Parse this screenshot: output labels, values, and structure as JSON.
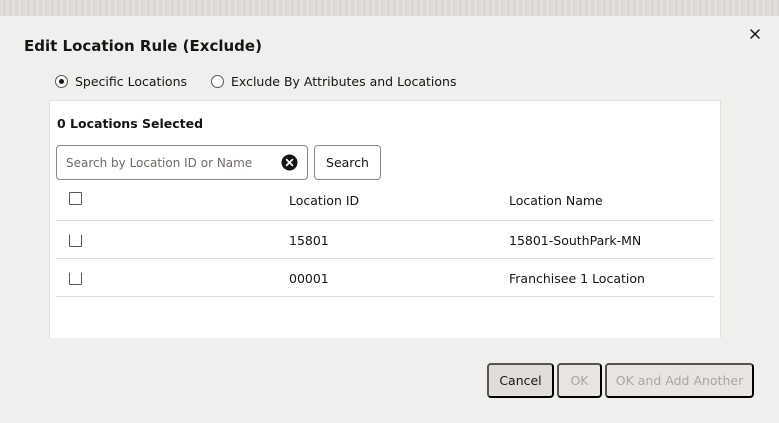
{
  "dialog": {
    "title": "Edit Location Rule (Exclude)",
    "close_icon": "close-icon"
  },
  "mode": {
    "options": [
      {
        "label": "Specific Locations",
        "selected": true
      },
      {
        "label": "Exclude By Attributes and Locations",
        "selected": false
      }
    ]
  },
  "selection": {
    "count_label": "0 Locations Selected"
  },
  "search": {
    "placeholder": "Search by Location ID or Name",
    "value": "",
    "clear_icon": "clear-circle-icon",
    "button_label": "Search"
  },
  "table": {
    "columns": [
      "Location ID",
      "Location Name"
    ],
    "rows": [
      {
        "id": "15801",
        "name": "15801-SouthPark-MN",
        "checked": false
      },
      {
        "id": "00001",
        "name": "Franchisee 1 Location",
        "checked": false
      }
    ]
  },
  "footer": {
    "cancel_label": "Cancel",
    "ok_label": "OK",
    "ok_add_label": "OK and Add Another"
  },
  "colors": {
    "background": "#f1efed",
    "panel": "#ffffff",
    "text": "#161513",
    "disabled_text": "#a9a5a0"
  }
}
